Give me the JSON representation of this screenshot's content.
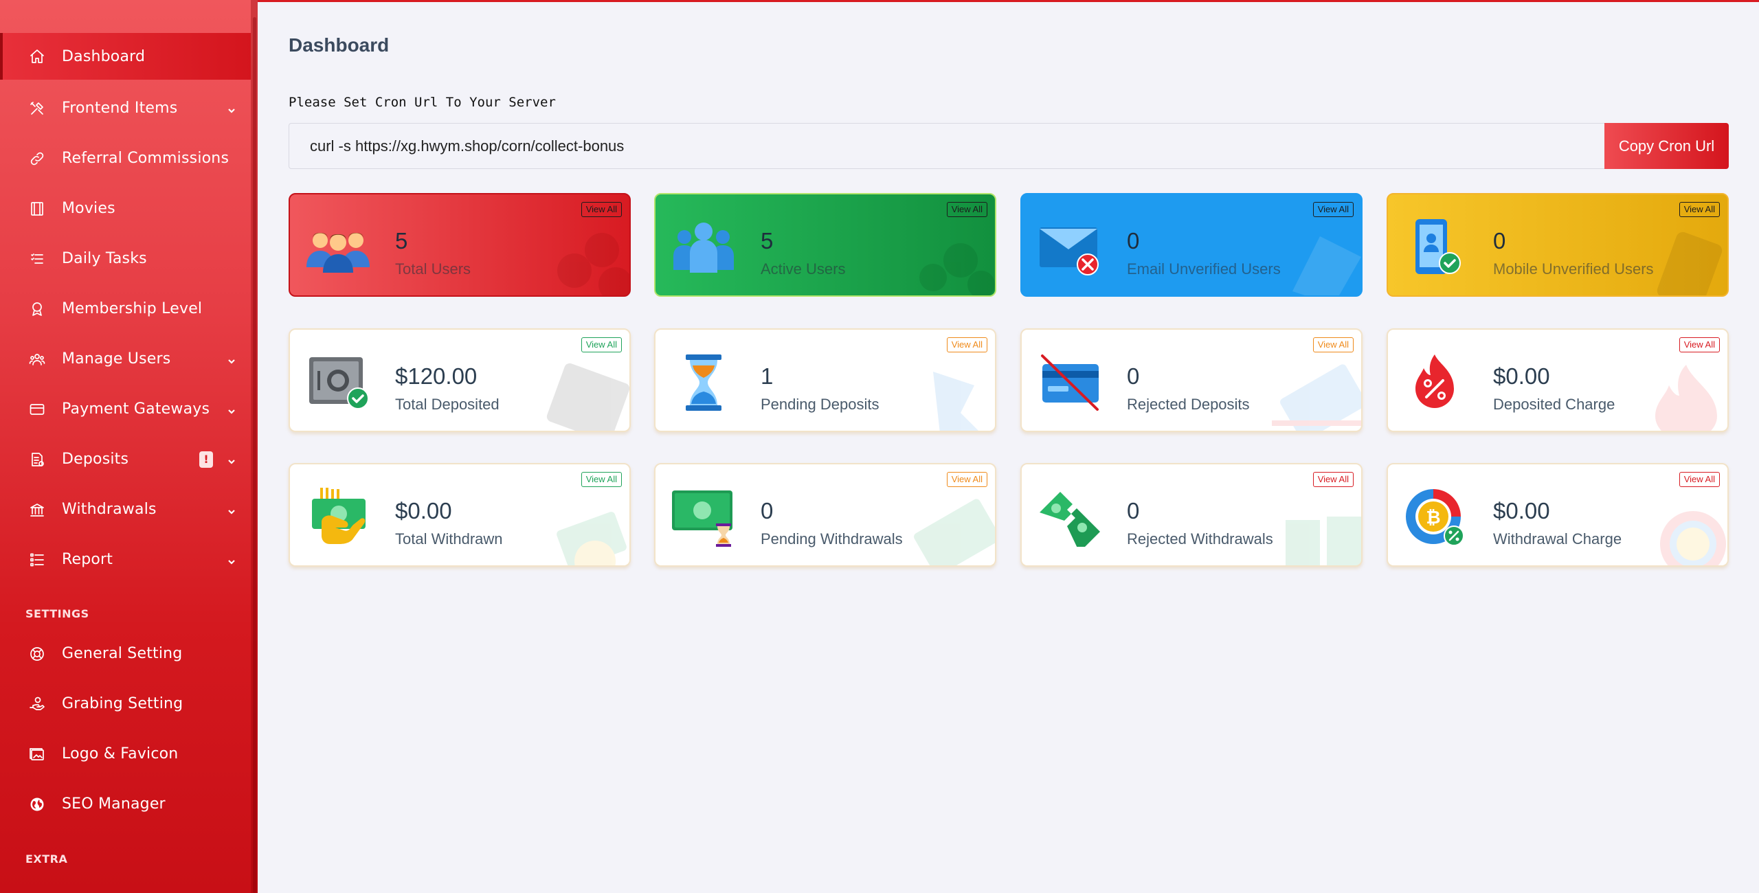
{
  "sidebar": {
    "items": [
      {
        "label": "Dashboard",
        "icon": "home-icon"
      },
      {
        "label": "Frontend Items",
        "icon": "tools-icon"
      },
      {
        "label": "Referral Commissions",
        "icon": "link-icon"
      },
      {
        "label": "Movies",
        "icon": "film-icon"
      },
      {
        "label": "Daily Tasks",
        "icon": "checklist-icon"
      },
      {
        "label": "Membership Level",
        "icon": "award-icon"
      },
      {
        "label": "Manage Users",
        "icon": "users-icon"
      },
      {
        "label": "Payment Gateways",
        "icon": "credit-card-icon"
      },
      {
        "label": "Deposits",
        "icon": "deposit-icon",
        "badge": "!"
      },
      {
        "label": "Withdrawals",
        "icon": "bank-icon"
      },
      {
        "label": "Report",
        "icon": "list-icon"
      }
    ],
    "settings_title": "SETTINGS",
    "settings_items": [
      {
        "label": "General Setting",
        "icon": "lifebuoy-icon"
      },
      {
        "label": "Grabing Setting",
        "icon": "hand-coin-icon"
      },
      {
        "label": "Logo & Favicon",
        "icon": "image-icon"
      },
      {
        "label": "SEO Manager",
        "icon": "globe-icon"
      }
    ],
    "extra_title": "EXTRA"
  },
  "page": {
    "title": "Dashboard",
    "cron_label": "Please Set Cron Url To Your Server",
    "cron_url": "curl -s https://xg.hwym.shop/corn/collect-bonus",
    "copy_button": "Copy Cron Url"
  },
  "cards_row1": [
    {
      "value": "5",
      "label": "Total Users",
      "view": "View All",
      "icon": "users-group-icon",
      "color": "#e5333b"
    },
    {
      "value": "5",
      "label": "Active Users",
      "view": "View All",
      "icon": "active-users-icon",
      "color": "#1aab4f"
    },
    {
      "value": "0",
      "label": "Email Unverified Users",
      "view": "View All",
      "icon": "envelope-x-icon",
      "color": "#1e9bf0"
    },
    {
      "value": "0",
      "label": "Mobile Unverified Users",
      "view": "View All",
      "icon": "mobile-check-icon",
      "color": "#f4b80f"
    }
  ],
  "cards_row2": [
    {
      "value": "$120.00",
      "label": "Total Deposited",
      "view": "View All",
      "icon": "safe-check-icon"
    },
    {
      "value": "1",
      "label": "Pending Deposits",
      "view": "View All",
      "icon": "hourglass-icon"
    },
    {
      "value": "0",
      "label": "Rejected Deposits",
      "view": "View All",
      "icon": "card-slash-icon"
    },
    {
      "value": "$0.00",
      "label": "Deposited Charge",
      "view": "View All",
      "icon": "fire-percent-icon"
    }
  ],
  "cards_row3": [
    {
      "value": "$0.00",
      "label": "Total Withdrawn",
      "view": "View All",
      "icon": "hand-cash-icon"
    },
    {
      "value": "0",
      "label": "Pending Withdrawals",
      "view": "View All",
      "icon": "cash-hourglass-icon"
    },
    {
      "value": "0",
      "label": "Rejected Withdrawals",
      "view": "View All",
      "icon": "torn-cash-icon"
    },
    {
      "value": "$0.00",
      "label": "Withdrawal Charge",
      "view": "View All",
      "icon": "bitcoin-percent-icon"
    }
  ]
}
